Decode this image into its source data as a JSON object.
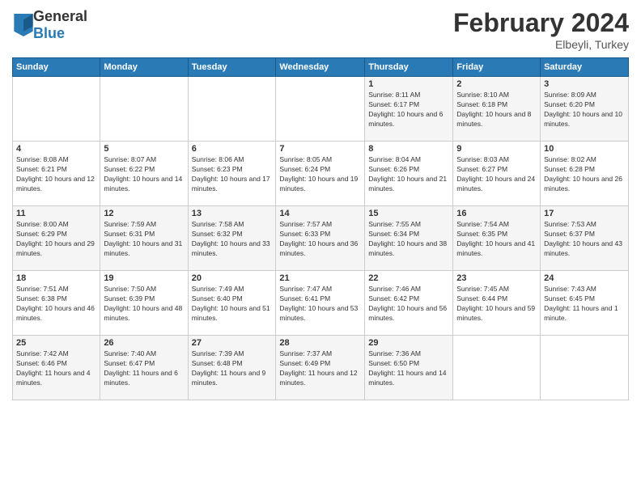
{
  "header": {
    "logo_general": "General",
    "logo_blue": "Blue",
    "month_title": "February 2024",
    "location": "Elbeyli, Turkey"
  },
  "days_of_week": [
    "Sunday",
    "Monday",
    "Tuesday",
    "Wednesday",
    "Thursday",
    "Friday",
    "Saturday"
  ],
  "weeks": [
    [
      {
        "day": "",
        "info": ""
      },
      {
        "day": "",
        "info": ""
      },
      {
        "day": "",
        "info": ""
      },
      {
        "day": "",
        "info": ""
      },
      {
        "day": "1",
        "info": "Sunrise: 8:11 AM\nSunset: 6:17 PM\nDaylight: 10 hours and 6 minutes."
      },
      {
        "day": "2",
        "info": "Sunrise: 8:10 AM\nSunset: 6:18 PM\nDaylight: 10 hours and 8 minutes."
      },
      {
        "day": "3",
        "info": "Sunrise: 8:09 AM\nSunset: 6:20 PM\nDaylight: 10 hours and 10 minutes."
      }
    ],
    [
      {
        "day": "4",
        "info": "Sunrise: 8:08 AM\nSunset: 6:21 PM\nDaylight: 10 hours and 12 minutes."
      },
      {
        "day": "5",
        "info": "Sunrise: 8:07 AM\nSunset: 6:22 PM\nDaylight: 10 hours and 14 minutes."
      },
      {
        "day": "6",
        "info": "Sunrise: 8:06 AM\nSunset: 6:23 PM\nDaylight: 10 hours and 17 minutes."
      },
      {
        "day": "7",
        "info": "Sunrise: 8:05 AM\nSunset: 6:24 PM\nDaylight: 10 hours and 19 minutes."
      },
      {
        "day": "8",
        "info": "Sunrise: 8:04 AM\nSunset: 6:26 PM\nDaylight: 10 hours and 21 minutes."
      },
      {
        "day": "9",
        "info": "Sunrise: 8:03 AM\nSunset: 6:27 PM\nDaylight: 10 hours and 24 minutes."
      },
      {
        "day": "10",
        "info": "Sunrise: 8:02 AM\nSunset: 6:28 PM\nDaylight: 10 hours and 26 minutes."
      }
    ],
    [
      {
        "day": "11",
        "info": "Sunrise: 8:00 AM\nSunset: 6:29 PM\nDaylight: 10 hours and 29 minutes."
      },
      {
        "day": "12",
        "info": "Sunrise: 7:59 AM\nSunset: 6:31 PM\nDaylight: 10 hours and 31 minutes."
      },
      {
        "day": "13",
        "info": "Sunrise: 7:58 AM\nSunset: 6:32 PM\nDaylight: 10 hours and 33 minutes."
      },
      {
        "day": "14",
        "info": "Sunrise: 7:57 AM\nSunset: 6:33 PM\nDaylight: 10 hours and 36 minutes."
      },
      {
        "day": "15",
        "info": "Sunrise: 7:55 AM\nSunset: 6:34 PM\nDaylight: 10 hours and 38 minutes."
      },
      {
        "day": "16",
        "info": "Sunrise: 7:54 AM\nSunset: 6:35 PM\nDaylight: 10 hours and 41 minutes."
      },
      {
        "day": "17",
        "info": "Sunrise: 7:53 AM\nSunset: 6:37 PM\nDaylight: 10 hours and 43 minutes."
      }
    ],
    [
      {
        "day": "18",
        "info": "Sunrise: 7:51 AM\nSunset: 6:38 PM\nDaylight: 10 hours and 46 minutes."
      },
      {
        "day": "19",
        "info": "Sunrise: 7:50 AM\nSunset: 6:39 PM\nDaylight: 10 hours and 48 minutes."
      },
      {
        "day": "20",
        "info": "Sunrise: 7:49 AM\nSunset: 6:40 PM\nDaylight: 10 hours and 51 minutes."
      },
      {
        "day": "21",
        "info": "Sunrise: 7:47 AM\nSunset: 6:41 PM\nDaylight: 10 hours and 53 minutes."
      },
      {
        "day": "22",
        "info": "Sunrise: 7:46 AM\nSunset: 6:42 PM\nDaylight: 10 hours and 56 minutes."
      },
      {
        "day": "23",
        "info": "Sunrise: 7:45 AM\nSunset: 6:44 PM\nDaylight: 10 hours and 59 minutes."
      },
      {
        "day": "24",
        "info": "Sunrise: 7:43 AM\nSunset: 6:45 PM\nDaylight: 11 hours and 1 minute."
      }
    ],
    [
      {
        "day": "25",
        "info": "Sunrise: 7:42 AM\nSunset: 6:46 PM\nDaylight: 11 hours and 4 minutes."
      },
      {
        "day": "26",
        "info": "Sunrise: 7:40 AM\nSunset: 6:47 PM\nDaylight: 11 hours and 6 minutes."
      },
      {
        "day": "27",
        "info": "Sunrise: 7:39 AM\nSunset: 6:48 PM\nDaylight: 11 hours and 9 minutes."
      },
      {
        "day": "28",
        "info": "Sunrise: 7:37 AM\nSunset: 6:49 PM\nDaylight: 11 hours and 12 minutes."
      },
      {
        "day": "29",
        "info": "Sunrise: 7:36 AM\nSunset: 6:50 PM\nDaylight: 11 hours and 14 minutes."
      },
      {
        "day": "",
        "info": ""
      },
      {
        "day": "",
        "info": ""
      }
    ]
  ]
}
